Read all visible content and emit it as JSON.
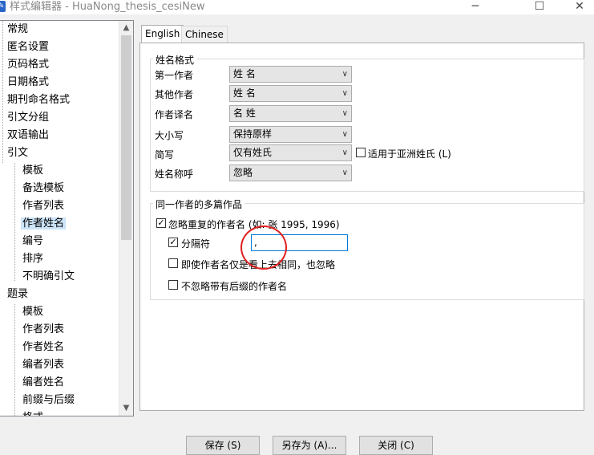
{
  "window": {
    "title": "样式编辑器 - HuaNong_thesis_cesiNew",
    "minimize_glyph": "─",
    "maximize_glyph": "☐",
    "close_glyph": "✕",
    "app_icon": "app-icon"
  },
  "tree": {
    "items": [
      {
        "label": "常规"
      },
      {
        "label": "匿名设置"
      },
      {
        "label": "页码格式"
      },
      {
        "label": "日期格式"
      },
      {
        "label": "期刊命名格式"
      },
      {
        "label": "引文分组"
      },
      {
        "label": "双语输出"
      },
      {
        "label": "引文"
      },
      {
        "label": "模板"
      },
      {
        "label": "备选模板"
      },
      {
        "label": "作者列表"
      },
      {
        "label": "作者姓名"
      },
      {
        "label": "编号"
      },
      {
        "label": "排序"
      },
      {
        "label": "不明确引文"
      },
      {
        "label": "题录"
      },
      {
        "label": "模板"
      },
      {
        "label": "作者列表"
      },
      {
        "label": "作者姓名"
      },
      {
        "label": "编者列表"
      },
      {
        "label": "编者姓名"
      },
      {
        "label": "前缀与后缀"
      },
      {
        "label": "格式"
      }
    ],
    "selected": "作者姓名"
  },
  "tabs": [
    {
      "label": "English",
      "active": true
    },
    {
      "label": "Chinese",
      "active": false
    }
  ],
  "name_format": {
    "group_title": "姓名格式",
    "rows": [
      {
        "label": "第一作者",
        "value": "姓 名"
      },
      {
        "label": "其他作者",
        "value": "姓 名"
      },
      {
        "label": "作者译名",
        "value": "名 姓"
      },
      {
        "label": "大小写",
        "value": "保持原样"
      },
      {
        "label": "简写",
        "value": "仅有姓氏"
      },
      {
        "label": "姓名称呼",
        "value": "忽略"
      }
    ],
    "asian_checkbox_label": "适用于亚洲姓氏 (L)",
    "asian_checked": false
  },
  "multiple_works": {
    "group_title": "同一作者的多篇作品",
    "ignore_repeated_label": "忽略重复的作者名 (如: 张 1995, 1996)",
    "ignore_repeated_checked": true,
    "separator_label": "分隔符",
    "separator_checked": true,
    "separator_value": ",",
    "ignore_even_if_label": "即使作者名仅是看上去相同，也忽略",
    "ignore_even_if_checked": false,
    "not_ignore_suffix_label": "不忽略带有后缀的作者名",
    "not_ignore_suffix_checked": false
  },
  "buttons": {
    "save": "保存 (S)",
    "save_as": "另存为 (A)...",
    "close": "关闭 (C)"
  },
  "colors": {
    "accent": "#0078d7",
    "highlight": "#cce4f7",
    "annotation_circle": "#e02020"
  }
}
